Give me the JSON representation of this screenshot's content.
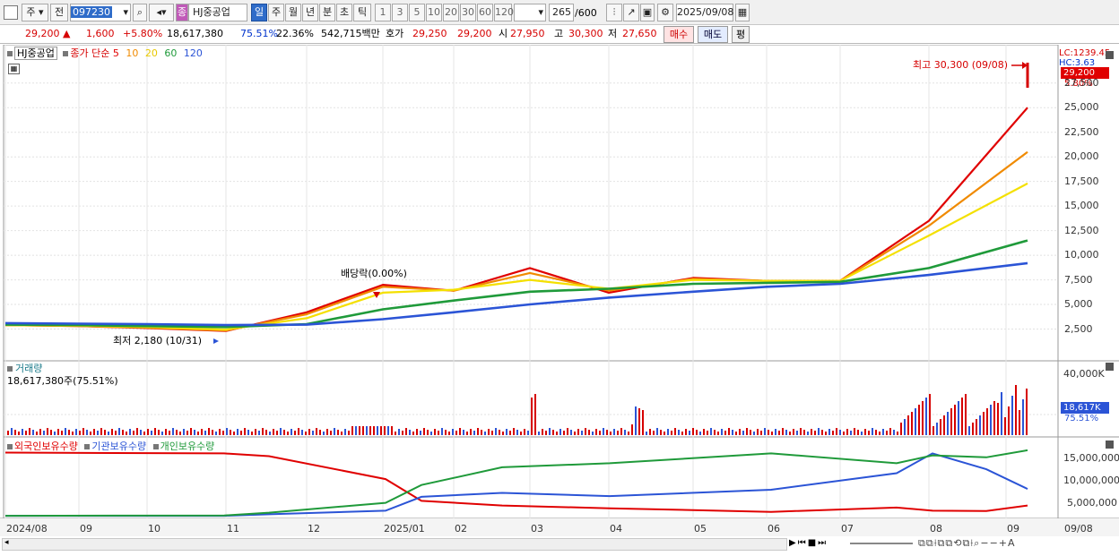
{
  "toolbar": {
    "type_sel": "주",
    "prev_label": "전",
    "code": "097230",
    "name_tag": "종",
    "name": "HJ중공업",
    "periods": [
      "일",
      "주",
      "월",
      "년",
      "분",
      "초",
      "틱"
    ],
    "active_period": "일",
    "units": [
      "1",
      "3",
      "5",
      "10",
      "20",
      "30",
      "60",
      "120"
    ],
    "count": "265",
    "count_total": "/600",
    "date": "2025/09/08"
  },
  "quote": {
    "price": "29,200",
    "change": "1,600",
    "change_pct": "+5.80%",
    "volume": "18,617,380",
    "vol_ratio": "75.51%",
    "turnover": "22.36%",
    "amount": "542,715백만",
    "bid_label": "호가",
    "bid1": "29,250",
    "bid2": "29,200",
    "open_label": "시",
    "open": "27,950",
    "high_label": "고",
    "high": "30,300",
    "low_label": "저",
    "low": "27,650",
    "buy_label": "매수",
    "sell_label": "매도",
    "eval_label": "평"
  },
  "price_panel": {
    "legend_name": "HJ중공업",
    "legend_ma": "종가 단순",
    "ma_periods": [
      "5",
      "10",
      "20",
      "60",
      "120"
    ],
    "ma_colors": [
      "#e00000",
      "#f08a00",
      "#f4e000",
      "#1f9a3a",
      "#2b54d6"
    ],
    "high_note": "최고 30,300 (09/08)",
    "low_note": "최저 2,180 (10/31)",
    "dividend_note": "배당락(0.00%)",
    "lc": "LC:1239.45",
    "hc": "HC:3.63",
    "price_tag": "29,200",
    "pct_tag": "5.80%",
    "y_ticks": [
      "27,500",
      "25,000",
      "22,500",
      "20,000",
      "17,500",
      "15,000",
      "12,500",
      "10,000",
      "7,500",
      "5,000",
      "2,500"
    ]
  },
  "volume_panel": {
    "title": "거래량",
    "value": "18,617,380주(75.51%)",
    "y_ticks": [
      "40,000K"
    ],
    "tag": "18,617K",
    "tag_pct": "75.51%"
  },
  "holding_panel": {
    "legend": [
      "외국인보유수량",
      "기관보유수량",
      "개인보유수량"
    ],
    "colors": [
      "#e00000",
      "#2b54d6",
      "#1f9a3a"
    ],
    "y_ticks": [
      "15,000,000",
      "10,000,000",
      "5,000,000"
    ]
  },
  "x_axis": {
    "labels": [
      "2024/08",
      "09",
      "10",
      "11",
      "12",
      "2025/01",
      "02",
      "03",
      "04",
      "05",
      "06",
      "07",
      "08",
      "09"
    ],
    "right_date": "09/08"
  },
  "chart_data": {
    "type": "line",
    "title": "",
    "xlabel": "",
    "ylabel": "",
    "ylim": [
      0,
      30300
    ],
    "x": [
      "2024/08",
      "09",
      "10",
      "11",
      "12",
      "2025/01",
      "02",
      "03",
      "04",
      "05",
      "06",
      "07",
      "08",
      "09"
    ],
    "series": [
      {
        "name": "5",
        "values": [
          2900,
          2800,
          2600,
          2300,
          4200,
          7000,
          6400,
          8700,
          6200,
          7700,
          7400,
          7400,
          13500,
          25000
        ]
      },
      {
        "name": "10",
        "values": [
          2900,
          2800,
          2650,
          2350,
          4000,
          6800,
          6400,
          8200,
          6400,
          7600,
          7400,
          7400,
          13000,
          20500
        ]
      },
      {
        "name": "20",
        "values": [
          2900,
          2850,
          2700,
          2450,
          3600,
          6200,
          6500,
          7500,
          6600,
          7500,
          7400,
          7400,
          12000,
          17300
        ]
      },
      {
        "name": "60",
        "values": [
          2950,
          2900,
          2800,
          2700,
          3000,
          4500,
          5400,
          6300,
          6600,
          7100,
          7200,
          7300,
          8700,
          11500
        ]
      },
      {
        "name": "120",
        "values": [
          3100,
          3050,
          3000,
          2900,
          2950,
          3500,
          4200,
          5000,
          5700,
          6300,
          6800,
          7100,
          8000,
          9200
        ]
      }
    ]
  }
}
